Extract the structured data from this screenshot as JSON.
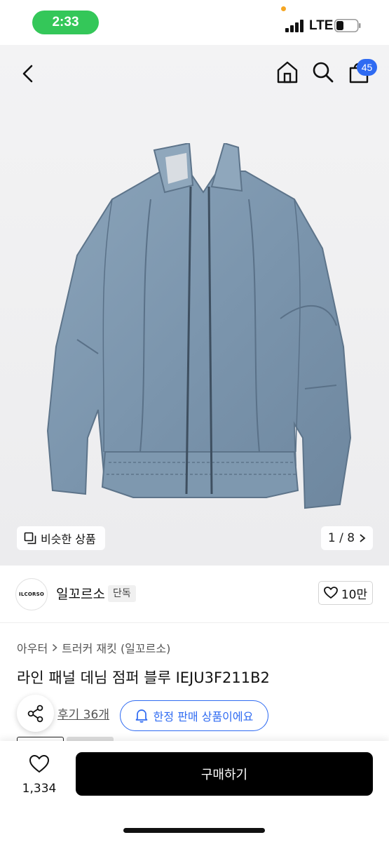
{
  "status_bar": {
    "time": "2:33",
    "network": "LTE"
  },
  "header": {
    "cart_count": "45"
  },
  "hero": {
    "similar_label": "비슷한 상품",
    "pager": "1 / 8"
  },
  "brand": {
    "logo_text": "ILCORSO",
    "name": "일꼬르소",
    "badge": "단독",
    "likes": "10만"
  },
  "breadcrumb": {
    "first": "아우터",
    "second": "트러커 재킷 (일꼬르소)"
  },
  "product": {
    "title": "라인 패널 데님 점퍼 블루 IEJU3F211B2"
  },
  "reviews": {
    "label": "후기 36개"
  },
  "limited": {
    "label": "한정 판매 상품이에요"
  },
  "bottom": {
    "wish_count": "1,334",
    "buy_label": "구매하기"
  },
  "colors": {
    "accent": "#2f6bf2",
    "status_green": "#34c759",
    "buy_bg": "#000000"
  }
}
